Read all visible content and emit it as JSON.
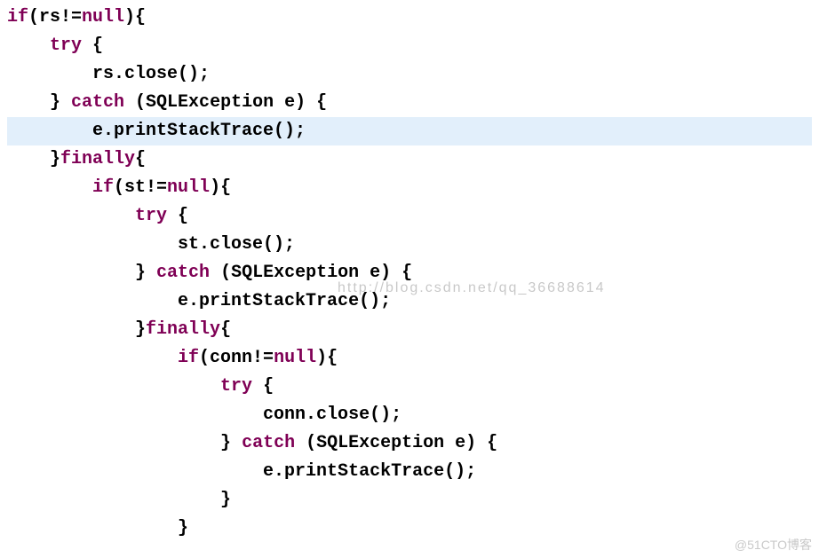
{
  "code": {
    "lines": [
      {
        "indent": 0,
        "hl": false,
        "tokens": [
          {
            "t": "kw",
            "v": "if"
          },
          {
            "t": "pl",
            "v": "(rs!="
          },
          {
            "t": "kw",
            "v": "null"
          },
          {
            "t": "pl",
            "v": "){"
          }
        ]
      },
      {
        "indent": 1,
        "hl": false,
        "tokens": [
          {
            "t": "kw",
            "v": "try"
          },
          {
            "t": "pl",
            "v": " {"
          }
        ]
      },
      {
        "indent": 2,
        "hl": false,
        "tokens": [
          {
            "t": "pl",
            "v": "rs.close();"
          }
        ]
      },
      {
        "indent": 1,
        "hl": false,
        "tokens": [
          {
            "t": "pl",
            "v": "} "
          },
          {
            "t": "kw",
            "v": "catch"
          },
          {
            "t": "pl",
            "v": " (SQLException e) {"
          }
        ]
      },
      {
        "indent": 2,
        "hl": true,
        "tokens": [
          {
            "t": "pl",
            "v": "e.printStackTrace();"
          }
        ]
      },
      {
        "indent": 1,
        "hl": false,
        "tokens": [
          {
            "t": "pl",
            "v": "}"
          },
          {
            "t": "kw",
            "v": "finally"
          },
          {
            "t": "pl",
            "v": "{"
          }
        ]
      },
      {
        "indent": 2,
        "hl": false,
        "tokens": [
          {
            "t": "kw",
            "v": "if"
          },
          {
            "t": "pl",
            "v": "(st!="
          },
          {
            "t": "kw",
            "v": "null"
          },
          {
            "t": "pl",
            "v": "){"
          }
        ]
      },
      {
        "indent": 3,
        "hl": false,
        "tokens": [
          {
            "t": "kw",
            "v": "try"
          },
          {
            "t": "pl",
            "v": " {"
          }
        ]
      },
      {
        "indent": 4,
        "hl": false,
        "tokens": [
          {
            "t": "pl",
            "v": "st.close();"
          }
        ]
      },
      {
        "indent": 3,
        "hl": false,
        "tokens": [
          {
            "t": "pl",
            "v": "} "
          },
          {
            "t": "kw",
            "v": "catch"
          },
          {
            "t": "pl",
            "v": " (SQLException e) {"
          }
        ]
      },
      {
        "indent": 4,
        "hl": false,
        "tokens": [
          {
            "t": "pl",
            "v": "e.printStackTrace();"
          }
        ]
      },
      {
        "indent": 3,
        "hl": false,
        "tokens": [
          {
            "t": "pl",
            "v": "}"
          },
          {
            "t": "kw",
            "v": "finally"
          },
          {
            "t": "pl",
            "v": "{"
          }
        ]
      },
      {
        "indent": 4,
        "hl": false,
        "tokens": [
          {
            "t": "kw",
            "v": "if"
          },
          {
            "t": "pl",
            "v": "(conn!="
          },
          {
            "t": "kw",
            "v": "null"
          },
          {
            "t": "pl",
            "v": "){"
          }
        ]
      },
      {
        "indent": 5,
        "hl": false,
        "tokens": [
          {
            "t": "kw",
            "v": "try"
          },
          {
            "t": "pl",
            "v": " {"
          }
        ]
      },
      {
        "indent": 6,
        "hl": false,
        "tokens": [
          {
            "t": "pl",
            "v": "conn.close();"
          }
        ]
      },
      {
        "indent": 5,
        "hl": false,
        "tokens": [
          {
            "t": "pl",
            "v": "} "
          },
          {
            "t": "kw",
            "v": "catch"
          },
          {
            "t": "pl",
            "v": " (SQLException e) {"
          }
        ]
      },
      {
        "indent": 6,
        "hl": false,
        "tokens": [
          {
            "t": "pl",
            "v": "e.printStackTrace();"
          }
        ]
      },
      {
        "indent": 5,
        "hl": false,
        "tokens": [
          {
            "t": "pl",
            "v": "}"
          }
        ]
      },
      {
        "indent": 4,
        "hl": false,
        "tokens": [
          {
            "t": "pl",
            "v": "}"
          }
        ]
      }
    ],
    "indent_unit": "    "
  },
  "watermark": "http://blog.csdn.net/qq_36688614",
  "source_attrib": "@51CTO博客"
}
